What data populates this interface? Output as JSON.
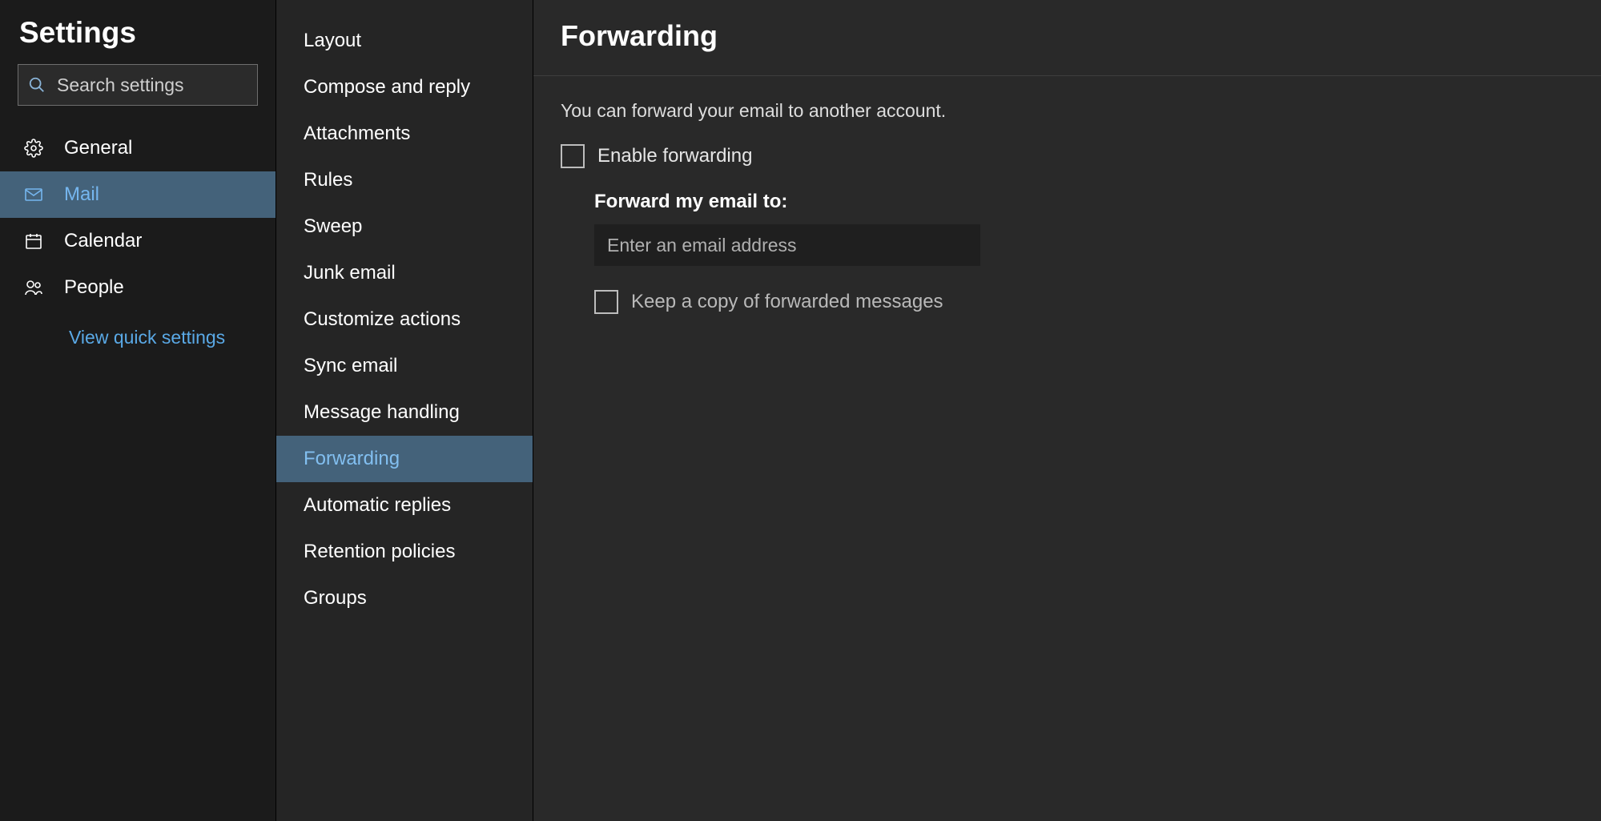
{
  "sidebar": {
    "title": "Settings",
    "search_placeholder": "Search settings",
    "items": [
      {
        "label": "General"
      },
      {
        "label": "Mail"
      },
      {
        "label": "Calendar"
      },
      {
        "label": "People"
      }
    ],
    "quick_link": "View quick settings"
  },
  "subnav": {
    "items": [
      {
        "label": "Layout"
      },
      {
        "label": "Compose and reply"
      },
      {
        "label": "Attachments"
      },
      {
        "label": "Rules"
      },
      {
        "label": "Sweep"
      },
      {
        "label": "Junk email"
      },
      {
        "label": "Customize actions"
      },
      {
        "label": "Sync email"
      },
      {
        "label": "Message handling"
      },
      {
        "label": "Forwarding"
      },
      {
        "label": "Automatic replies"
      },
      {
        "label": "Retention policies"
      },
      {
        "label": "Groups"
      }
    ]
  },
  "main": {
    "title": "Forwarding",
    "description": "You can forward your email to another account.",
    "enable_label": "Enable forwarding",
    "forward_to_label": "Forward my email to:",
    "forward_to_placeholder": "Enter an email address",
    "keep_copy_label": "Keep a copy of forwarded messages"
  }
}
